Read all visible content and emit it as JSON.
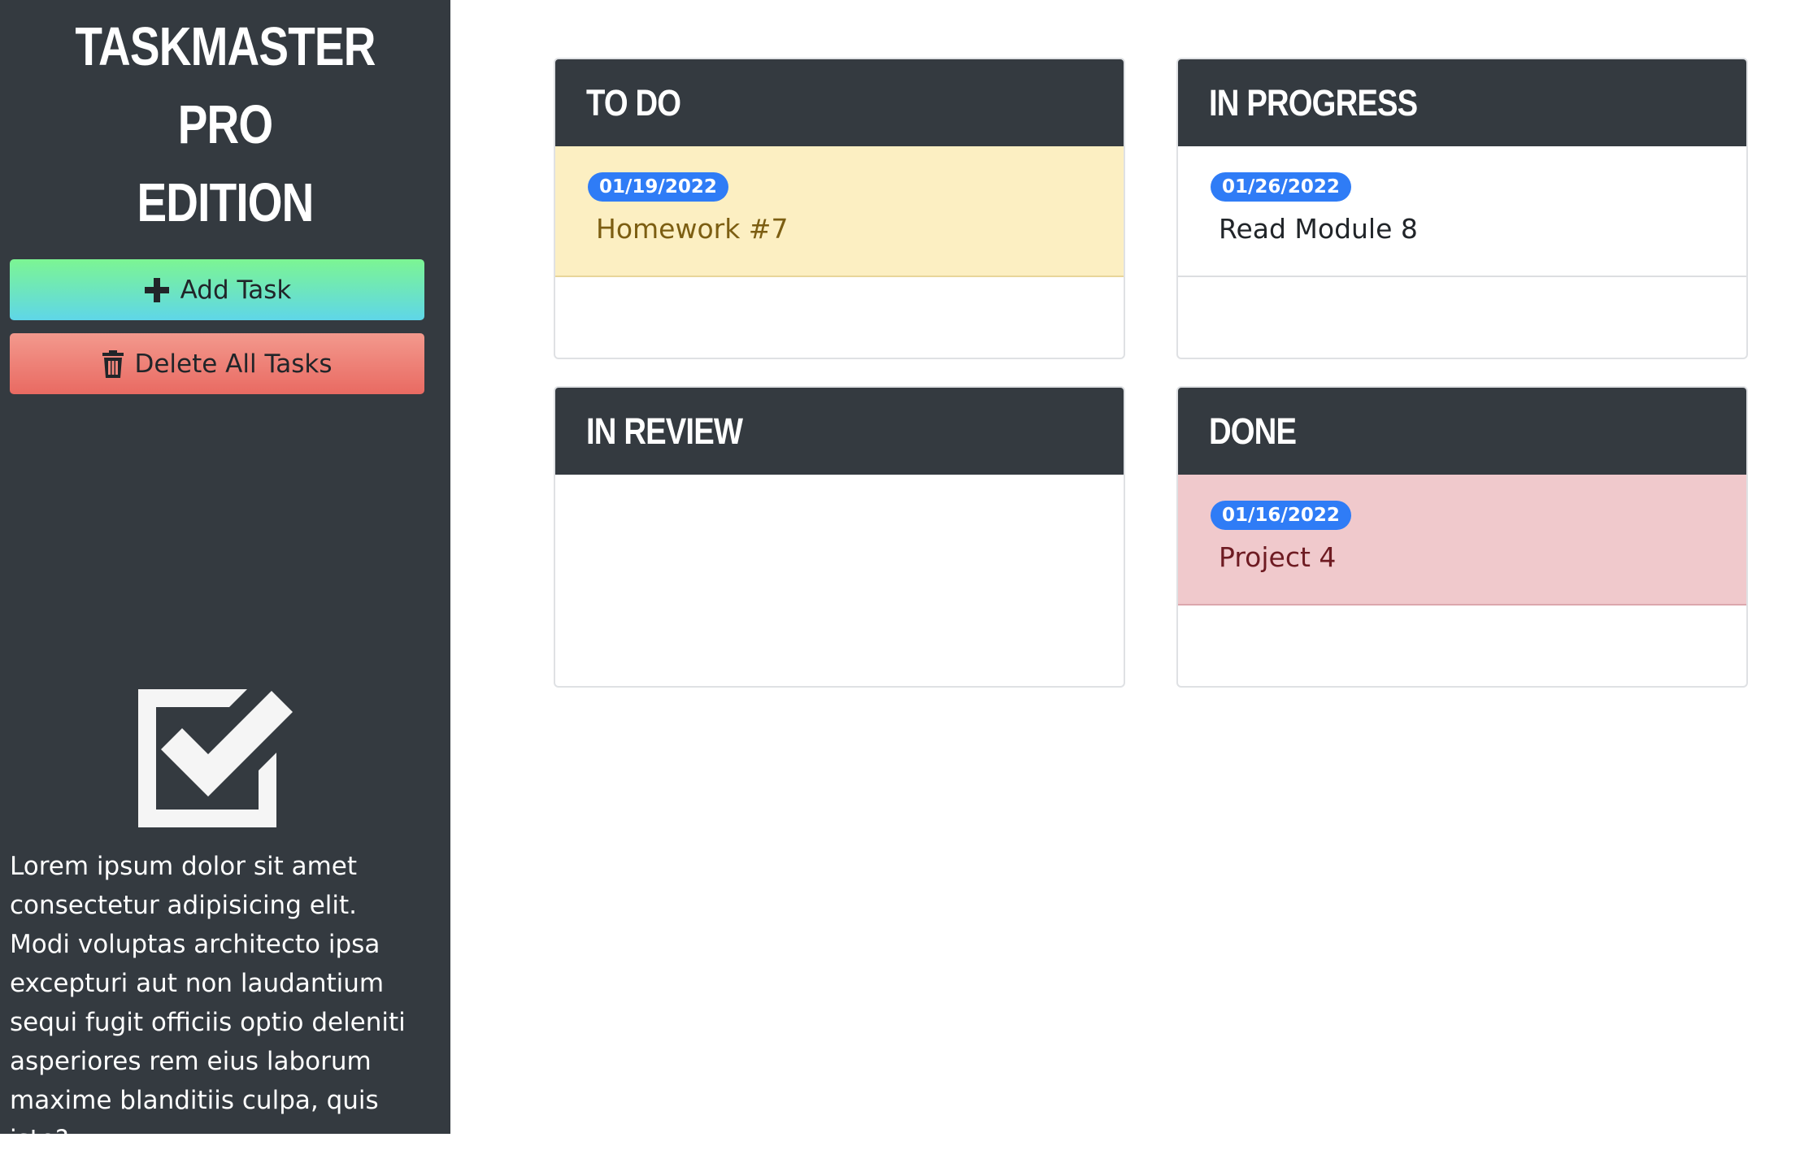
{
  "app": {
    "title_line1": "TASKMASTER PRO",
    "title_line2": "EDITION"
  },
  "sidebar": {
    "add_task_label": "Add Task",
    "delete_all_label": "Delete All Tasks",
    "illustration_icon": "checkbox-check-icon",
    "description": "Lorem ipsum dolor sit amet consectetur adipisicing elit. Modi voluptas architecto ipsa excepturi aut non laudantium sequi fugit officiis optio deleniti asperiores rem eius laborum maxime blanditiis culpa, quis iste?"
  },
  "columns": {
    "todo": {
      "title": "To Do",
      "tasks": [
        {
          "date": "01/19/2022",
          "name": "Homework #7",
          "status": "warning"
        }
      ]
    },
    "in_progress": {
      "title": "In Progress",
      "tasks": [
        {
          "date": "01/26/2022",
          "name": "Read Module 8",
          "status": "light"
        }
      ]
    },
    "in_review": {
      "title": "In Review",
      "tasks": []
    },
    "done": {
      "title": "Done",
      "tasks": [
        {
          "date": "01/16/2022",
          "name": "Project 4",
          "status": "danger"
        }
      ]
    }
  },
  "colors": {
    "sidebar_bg": "#343a40",
    "header_bg": "#343a40",
    "badge_bg": "#2f7cf6",
    "warning_card": "#fcefc2",
    "danger_card": "#f0c9cc",
    "add_button_gradient": [
      "#7cf593",
      "#5fd6e8"
    ],
    "delete_button_gradient": [
      "#f3998d",
      "#e96a62"
    ]
  }
}
